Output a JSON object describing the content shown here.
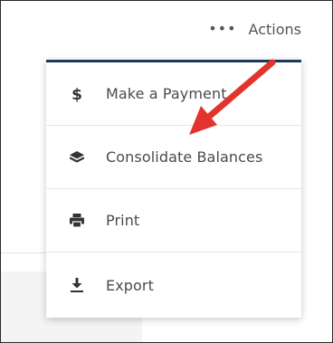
{
  "header": {
    "actions_label": "Actions",
    "actions_icon": "ellipsis-icon"
  },
  "menu": {
    "accent_color": "#1b3a5a",
    "items": [
      {
        "label": "Make a Payment",
        "icon": "dollar-icon"
      },
      {
        "label": "Consolidate Balances",
        "icon": "layers-icon"
      },
      {
        "label": "Print",
        "icon": "printer-icon"
      },
      {
        "label": "Export",
        "icon": "download-icon"
      }
    ]
  },
  "annotation": {
    "arrow_color": "#e2342c",
    "icon": "red-arrow-icon"
  }
}
